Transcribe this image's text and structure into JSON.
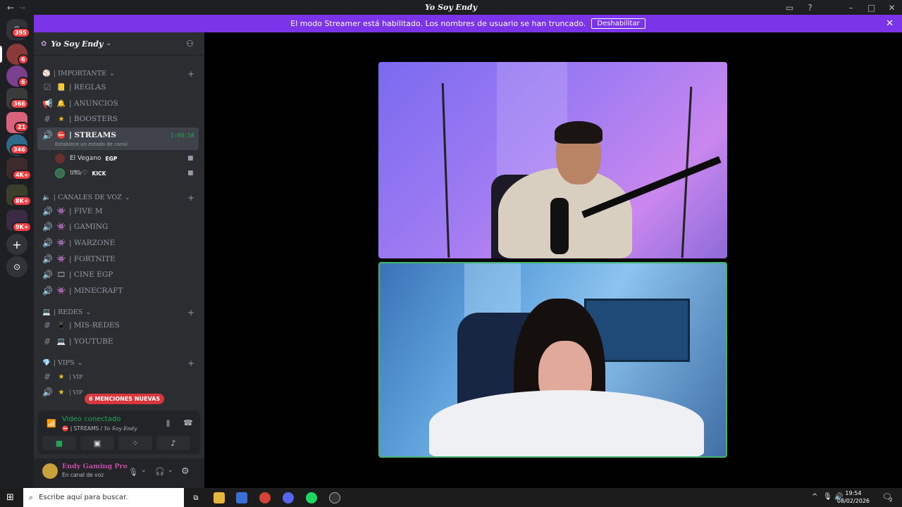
{
  "window": {
    "title": "Yo Soy Endy"
  },
  "banner": {
    "text": "El modo Streamer está habilitado. Los nombres de usuario se han truncado.",
    "button": "Deshabilitar"
  },
  "rail_badges": [
    "395",
    "6",
    "6",
    "366",
    "21",
    "346",
    "4K+",
    "8K+",
    "9K+"
  ],
  "server": {
    "name": "Yo Soy Endy"
  },
  "categories": {
    "importante": "| IMPORTANTE",
    "voz": "| CANALES DE VOZ",
    "redes": "| REDES",
    "vips": "| VIPS"
  },
  "channels": {
    "reglas": "| REGLAS",
    "anuncios": "| ANUNCIOS",
    "boosters": "| BOOSTERS",
    "streams": "| STREAMS",
    "streams_timer": "2:00:58",
    "streams_status": "Establece un estado de canal",
    "fivem": "| FIVE M",
    "gaming": "|  GAMING",
    "warzone": "| WARZONE",
    "fortnite": "| FORTNITE",
    "cine": "| CINE EGP",
    "minecraft": "| MINECRAFT",
    "misredes": "| MIS-REDES",
    "youtube": "| YOUTUBE",
    "vip1": "| VIP",
    "vip2": "| VIP"
  },
  "voice_users": [
    {
      "name": "El Vegano",
      "tag": "EGP"
    },
    {
      "name": "𝔘𝔄𝔩𝔢♡",
      "tag": "KICK"
    }
  ],
  "mentions": "6 MENCIONES NUEVAS",
  "voice_panel": {
    "status": "Video conectado",
    "channel": "| STREAMS / ",
    "server": "Yo Soy Endy"
  },
  "user_panel": {
    "name": "Endy Gaming Pro",
    "status": "En canal de voz"
  },
  "taskbar": {
    "search_placeholder": "Escribe aquí para buscar.",
    "time": "19:54",
    "date": "08/02/2026",
    "notif": "2"
  }
}
